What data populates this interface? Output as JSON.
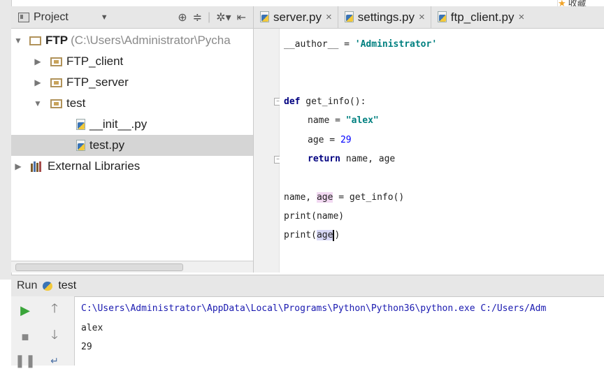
{
  "project_panel": {
    "title": "Project",
    "dropdown_icon": "chevron-down-icon",
    "tool_icons": [
      "locate-icon",
      "collapse-all-icon",
      "settings-icon",
      "hide-panel-icon"
    ]
  },
  "editor_tabs": [
    {
      "label": "server.py",
      "close": "×"
    },
    {
      "label": "settings.py",
      "close": "×"
    },
    {
      "label": "ftp_client.py",
      "close": "×"
    }
  ],
  "favorite": {
    "label": "收藏"
  },
  "tree": {
    "root": {
      "label": "FTP",
      "path": "(C:\\Users\\Administrator\\Pycha"
    },
    "items": [
      {
        "label": "FTP_client"
      },
      {
        "label": "FTP_server"
      },
      {
        "label": "test"
      },
      {
        "label": "__init__.py"
      },
      {
        "label": "test.py"
      },
      {
        "label": "External Libraries"
      }
    ]
  },
  "code": {
    "line1": {
      "name": "__author__",
      "op": " = ",
      "str": "'Administrator'"
    },
    "line2": {
      "kw": "def",
      "rest": " get_info():"
    },
    "line3": {
      "name": "name",
      "op": " = ",
      "str": "\"alex\""
    },
    "line4": {
      "name": "age",
      "op": " = ",
      "num": "29"
    },
    "line5": {
      "kw": "return",
      "rest": " name, age"
    },
    "line6": {
      "pre": "name, ",
      "age": "age",
      "post": " = get_info()"
    },
    "line7": {
      "text": "print(name)"
    },
    "line8": {
      "pre": "print(",
      "age": "age",
      "post": ")"
    }
  },
  "run": {
    "label": "Run",
    "config": "test",
    "console": [
      "C:\\Users\\Administrator\\AppData\\Local\\Programs\\Python\\Python36\\python.exe C:/Users/Adm",
      "alex",
      "29"
    ]
  }
}
